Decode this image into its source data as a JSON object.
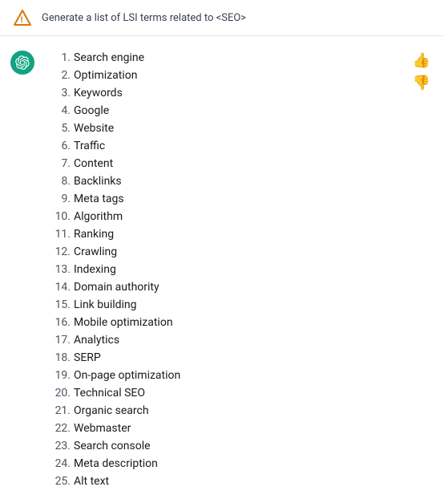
{
  "topbar": {
    "prompt": "Generate a list of LSI terms related to <SEO>"
  },
  "list": {
    "items": [
      {
        "num": "1.",
        "text": "Search engine"
      },
      {
        "num": "2.",
        "text": "Optimization"
      },
      {
        "num": "3.",
        "text": "Keywords"
      },
      {
        "num": "4.",
        "text": "Google"
      },
      {
        "num": "5.",
        "text": "Website"
      },
      {
        "num": "6.",
        "text": "Traffic"
      },
      {
        "num": "7.",
        "text": "Content"
      },
      {
        "num": "8.",
        "text": "Backlinks"
      },
      {
        "num": "9.",
        "text": "Meta tags"
      },
      {
        "num": "10.",
        "text": "Algorithm"
      },
      {
        "num": "11.",
        "text": "Ranking"
      },
      {
        "num": "12.",
        "text": "Crawling"
      },
      {
        "num": "13.",
        "text": "Indexing"
      },
      {
        "num": "14.",
        "text": "Domain authority"
      },
      {
        "num": "15.",
        "text": "Link building"
      },
      {
        "num": "16.",
        "text": "Mobile optimization"
      },
      {
        "num": "17.",
        "text": "Analytics"
      },
      {
        "num": "18.",
        "text": "SERP"
      },
      {
        "num": "19.",
        "text": "On-page optimization"
      },
      {
        "num": "20.",
        "text": "Technical SEO"
      },
      {
        "num": "21.",
        "text": "Organic search"
      },
      {
        "num": "22.",
        "text": "Webmaster"
      },
      {
        "num": "23.",
        "text": "Search console"
      },
      {
        "num": "24.",
        "text": "Meta description"
      },
      {
        "num": "25.",
        "text": "Alt text"
      }
    ]
  },
  "actions": {
    "thumbsUp": "👍",
    "thumbsDown": "👎"
  }
}
